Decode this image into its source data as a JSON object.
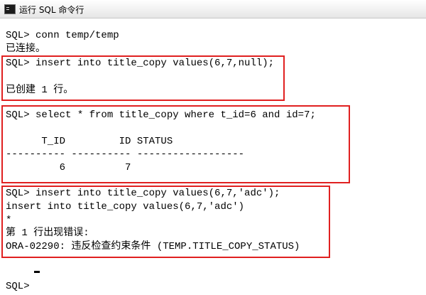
{
  "window": {
    "title": "运行 SQL 命令行",
    "icon": "terminal-icon"
  },
  "console": {
    "lines": [
      "SQL> conn temp/temp",
      "已连接。",
      "SQL> insert into title_copy values(6,7,null);",
      "已创建 1 行。",
      "SQL> select * from title_copy where t_id=6 and id=7;",
      "      T_ID         ID STATUS",
      "---------- ---------- ------------------",
      "         6          7",
      "SQL> insert into title_copy values(6,7,'adc');",
      "insert into title_copy values(6,7,'adc')",
      "*",
      "第 1 行出现错误:",
      "ORA-02290: 违反检查约束条件 (TEMP.TITLE_COPY_STATUS)",
      "SQL> "
    ]
  },
  "colors": {
    "highlight": "#e02020",
    "text": "#000000",
    "background": "#ffffff"
  }
}
